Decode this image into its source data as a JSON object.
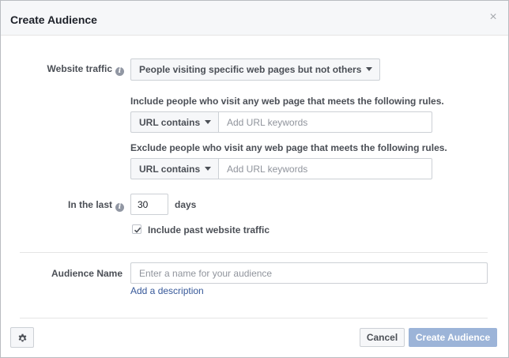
{
  "dialog": {
    "title": "Create Audience",
    "close_glyph": "×"
  },
  "website_traffic": {
    "label": "Website traffic",
    "selected": "People visiting specific web pages but not others"
  },
  "include": {
    "text": "Include people who visit any web page that meets the following rules.",
    "operator": "URL contains",
    "placeholder": "Add URL keywords"
  },
  "exclude": {
    "text": "Exclude people who visit any web page that meets the following rules.",
    "operator": "URL contains",
    "placeholder": "Add URL keywords"
  },
  "in_the_last": {
    "label": "In the last",
    "value": "30",
    "unit": "days"
  },
  "past_traffic": {
    "label": "Include past website traffic",
    "checked": true
  },
  "audience_name": {
    "label": "Audience Name",
    "placeholder": "Enter a name for your audience",
    "add_description": "Add a description"
  },
  "footer": {
    "cancel_label": "Cancel",
    "create_label": "Create Audience"
  },
  "icons": {
    "info": "info-icon",
    "close": "close-icon",
    "gear": "gear-icon",
    "check": "check-icon",
    "caret": "caret-down-icon"
  },
  "colors": {
    "primary_disabled": "#9cb4d8",
    "link": "#365899",
    "text": "#4b4f56"
  }
}
